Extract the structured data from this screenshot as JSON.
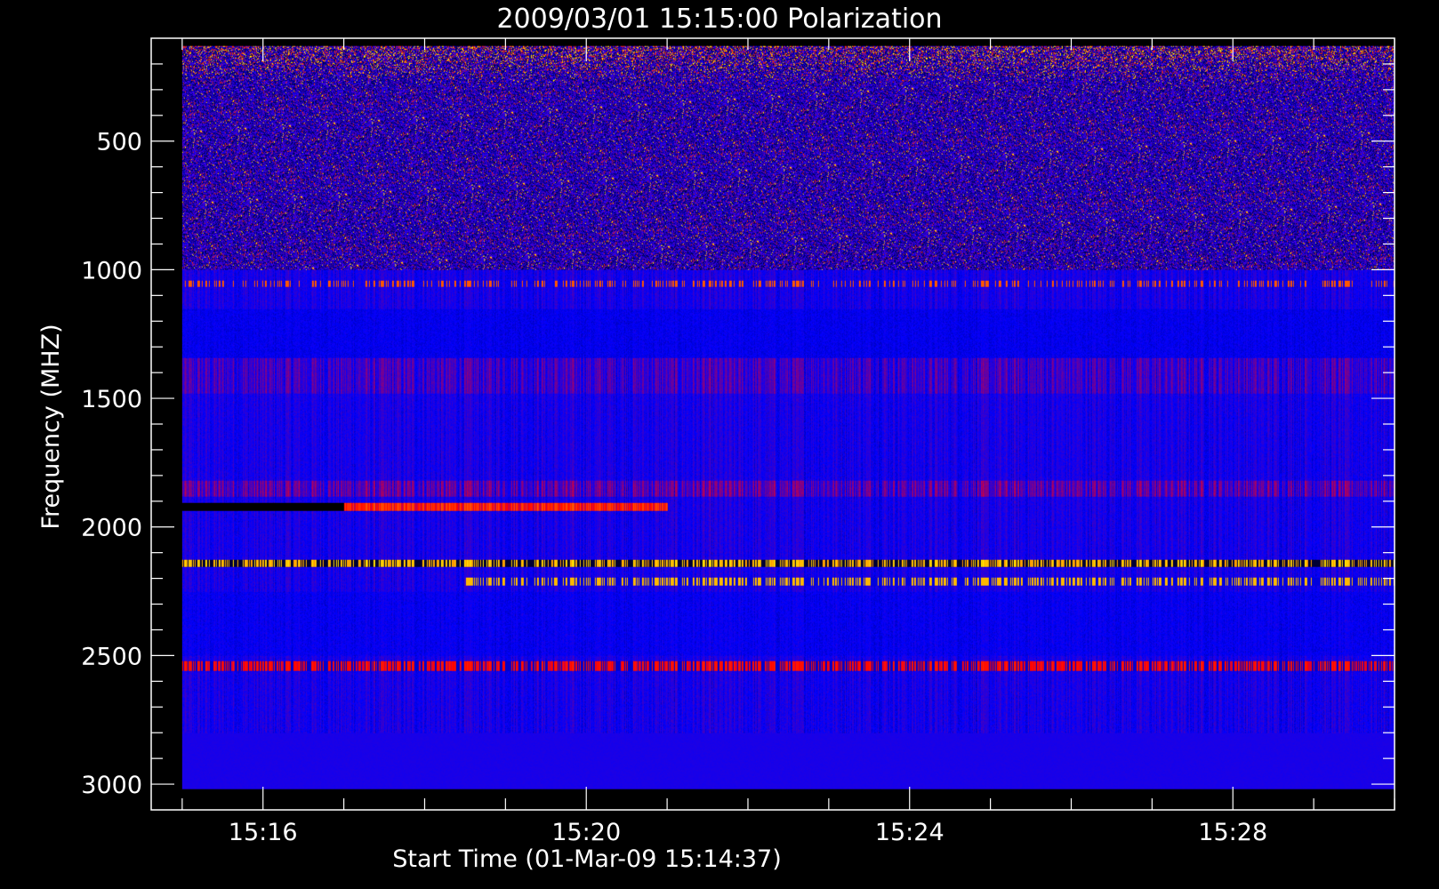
{
  "chart_data": {
    "type": "heatmap",
    "title": "2009/03/01 15:15:00 Polarization",
    "xlabel": "Start Time (01-Mar-09 15:14:37)",
    "ylabel": "Frequency (MHZ)",
    "x_axis": {
      "unit": "time",
      "range": [
        "15:14:37",
        "15:30:00"
      ],
      "data_range": [
        "15:15:00",
        "15:30:00"
      ],
      "major_ticks": [
        "15:16",
        "15:20",
        "15:24",
        "15:28"
      ],
      "minor_tick_step_minutes": 1
    },
    "y_axis": {
      "unit": "MHz",
      "reversed": true,
      "range": [
        100,
        3100
      ],
      "data_range": [
        130,
        3020
      ],
      "major_ticks": [
        500,
        1000,
        1500,
        2000,
        2500,
        3000
      ],
      "minor_tick_step": 100
    },
    "colormap": [
      "#000000",
      "#0000ff",
      "#ff0000",
      "#ffff00"
    ],
    "colors": {
      "background": "#000000",
      "axes": "#ffffff",
      "dominant": "#1010ff"
    },
    "grid": false,
    "legend": "none",
    "features": [
      {
        "kind": "band",
        "freq_mhz": [
          130,
          1000
        ],
        "time": [
          "15:15:00",
          "15:30:00"
        ],
        "pattern": "noisy blue/red/yellow speckle"
      },
      {
        "kind": "line",
        "freq_mhz": 1920,
        "time": [
          "15:15:00",
          "15:17:00"
        ],
        "color": "black"
      },
      {
        "kind": "line",
        "freq_mhz": 1920,
        "time": [
          "15:17:00",
          "15:21:00"
        ],
        "color": "red-orange"
      },
      {
        "kind": "line",
        "freq_mhz": 2140,
        "time": [
          "15:15:00",
          "15:30:00"
        ],
        "color": "yellow and black"
      },
      {
        "kind": "line",
        "freq_mhz": 2210,
        "time": [
          "15:18:30",
          "15:30:00"
        ],
        "color": "yellow"
      },
      {
        "kind": "line",
        "freq_mhz": 2540,
        "time": [
          "15:15:00",
          "15:30:00"
        ],
        "color": "red"
      },
      {
        "kind": "band",
        "freq_mhz": [
          1340,
          1480
        ],
        "time": [
          "15:15:00",
          "15:30:00"
        ],
        "color": "dark red"
      },
      {
        "kind": "band",
        "freq_mhz": [
          1820,
          1880
        ],
        "time": [
          "15:15:00",
          "15:30:00"
        ],
        "color": "red"
      }
    ]
  }
}
